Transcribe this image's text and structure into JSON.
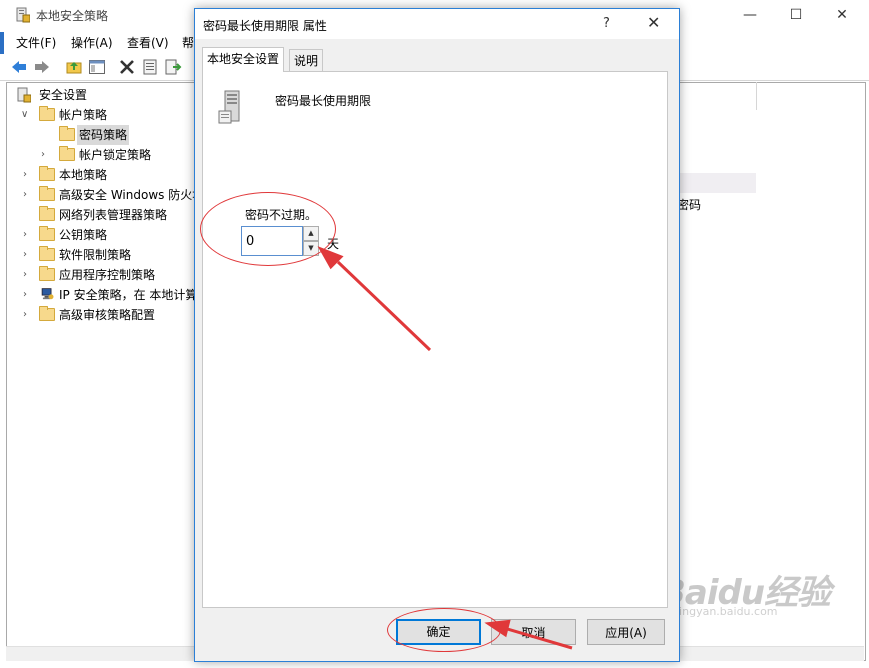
{
  "main_window": {
    "title": "本地安全策略",
    "menu": [
      "文件(F)",
      "操作(A)",
      "查看(V)",
      "帮"
    ],
    "window_buttons": [
      "—",
      "☐",
      "✕"
    ],
    "tree": [
      {
        "label": "安全设置",
        "arrow": ""
      },
      {
        "label": "帐户策略",
        "arrow": "∨"
      },
      {
        "label": "密码策略",
        "arrow": ""
      },
      {
        "label": "帐户锁定策略",
        "arrow": "›"
      },
      {
        "label": "本地策略",
        "arrow": "›"
      },
      {
        "label": "高级安全 Windows 防火墙",
        "arrow": "›"
      },
      {
        "label": "网络列表管理器策略",
        "arrow": ""
      },
      {
        "label": "公钥策略",
        "arrow": "›"
      },
      {
        "label": "软件限制策略",
        "arrow": "›"
      },
      {
        "label": "应用程序控制策略",
        "arrow": "›"
      },
      {
        "label": "IP 安全策略，在 本地计算机",
        "arrow": "›"
      },
      {
        "label": "高级审核策略配置",
        "arrow": "›"
      }
    ],
    "right_partial_text": "密码"
  },
  "dialog": {
    "title": "密码最长使用期限 属性",
    "help": "?",
    "close": "✕",
    "tabs": [
      "本地安全设置",
      "说明"
    ],
    "policy_name": "密码最长使用期限",
    "expire_label": "密码不过期。",
    "days_value": "0",
    "unit": "天",
    "buttons": {
      "ok": "确定",
      "cancel": "取消",
      "apply": "应用(A)"
    }
  },
  "watermark": {
    "text": "Baidu经验",
    "sub": "jingyan.baidu.com"
  },
  "colors": {
    "accent": "#2b6fc4",
    "dialog_border": "#2b7fd6",
    "annotation": "#e0383a",
    "folder": "#f7d98c"
  }
}
